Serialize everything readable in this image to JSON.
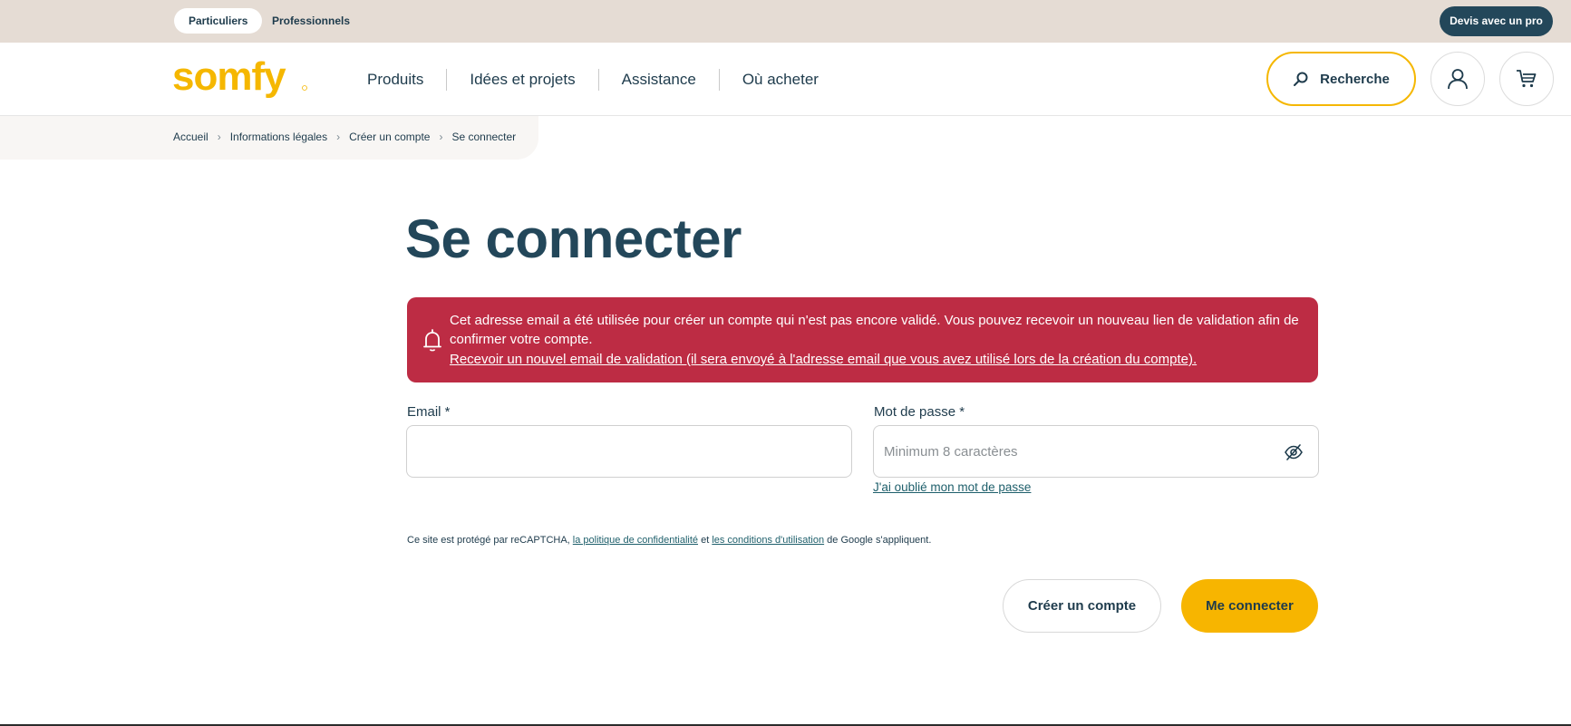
{
  "topbar": {
    "segments": [
      "Particuliers",
      "Professionnels"
    ],
    "cta": "Devis avec un pro"
  },
  "header": {
    "logo_text": "somfy",
    "nav": [
      "Produits",
      "Idées et projets",
      "Assistance",
      "Où acheter"
    ],
    "search_label": "Recherche",
    "icons": [
      "search-icon",
      "user-icon",
      "cart-icon"
    ]
  },
  "breadcrumb": [
    "Accueil",
    "Informations légales",
    "Créer un compte",
    "Se connecter"
  ],
  "page": {
    "title": "Se connecter"
  },
  "alert": {
    "message": "Cet adresse email a été utilisée pour créer un compte qui n'est pas encore validé. Vous pouvez recevoir un nouveau lien de validation afin de confirmer votre compte.",
    "link": "Recevoir un nouvel email de validation (il sera envoyé à l'adresse email que vous avez utilisé lors de la création du compte).",
    "icon": "bell-icon"
  },
  "form": {
    "email_label": "Email  *",
    "email_value": "",
    "password_label": "Mot de passe  *",
    "password_placeholder": "Minimum 8 caractères",
    "forgot": "J'ai oublié mon mot de passe"
  },
  "recaptcha": {
    "prefix": "Ce site est protégé par reCAPTCHA, ",
    "privacy": "la politique de confidentialité",
    "middle": " et ",
    "terms": "les conditions d'utilisation",
    "suffix": " de Google s'appliquent."
  },
  "actions": {
    "create": "Créer un compte",
    "connect": "Me connecter"
  },
  "colors": {
    "brand_yellow": "#f7b500",
    "navy": "#23475a",
    "alert_red": "#bd2c44",
    "topbar_beige": "#e5dcd4"
  }
}
